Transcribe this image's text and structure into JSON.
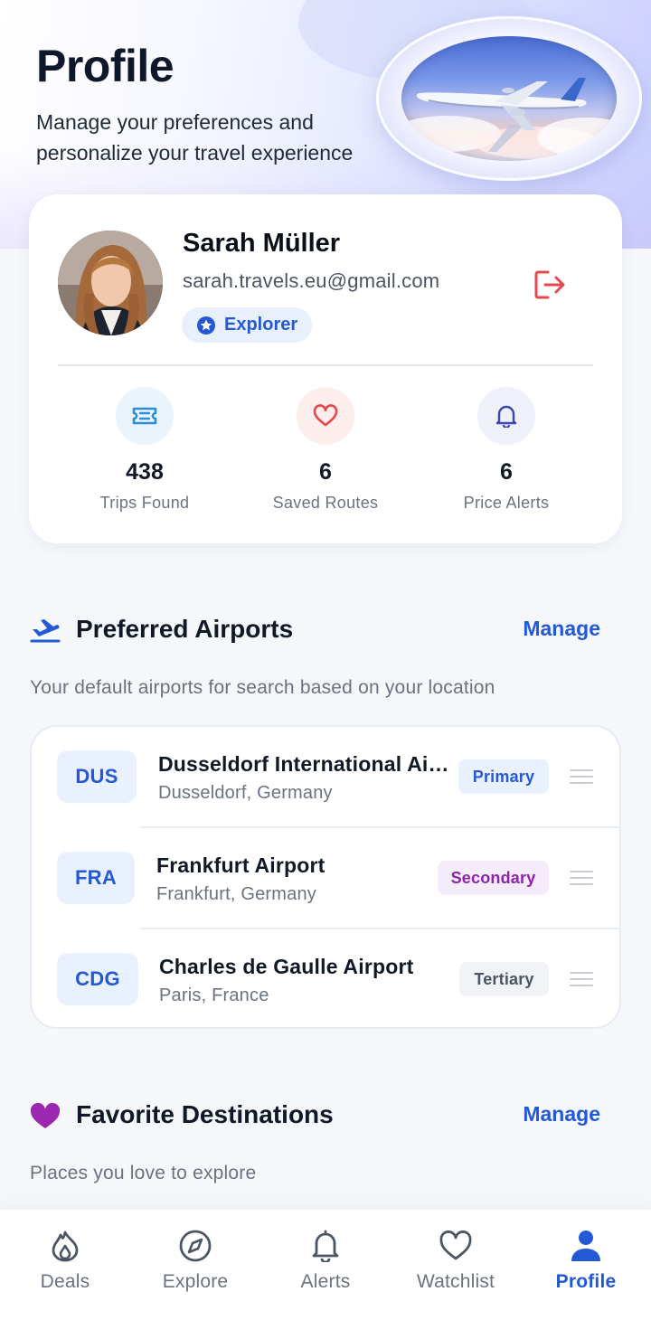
{
  "header": {
    "title": "Profile",
    "subtitle": "Manage your preferences and personalize your travel experience"
  },
  "user": {
    "name": "Sarah Müller",
    "email": "sarah.travels.eu@gmail.com",
    "tier": "Explorer"
  },
  "stats": [
    {
      "icon": "ticket-icon",
      "value": "438",
      "label": "Trips Found",
      "color": "#2b8fd6",
      "bg": "#eaf4fd"
    },
    {
      "icon": "heart-icon",
      "value": "6",
      "label": "Saved Routes",
      "color": "#e5484d",
      "bg": "#fdeeee"
    },
    {
      "icon": "bell-icon",
      "value": "6",
      "label": "Price Alerts",
      "color": "#3b47b8",
      "bg": "#eef0fa"
    }
  ],
  "preferred_airports": {
    "title": "Preferred Airports",
    "manage_label": "Manage",
    "description": "Your default airports for search based on your location",
    "items": [
      {
        "code": "DUS",
        "name": "Dusseldorf International Airport",
        "location": "Dusseldorf, Germany",
        "rank": "Primary",
        "rank_color": "#2459d6",
        "rank_bg": "#eaf1fe"
      },
      {
        "code": "FRA",
        "name": "Frankfurt Airport",
        "location": "Frankfurt, Germany",
        "rank": "Secondary",
        "rank_color": "#8e24aa",
        "rank_bg": "#f4ecfb"
      },
      {
        "code": "CDG",
        "name": "Charles de Gaulle Airport",
        "location": "Paris, France",
        "rank": "Tertiary",
        "rank_color": "#4b5563",
        "rank_bg": "#f1f3f6"
      }
    ]
  },
  "favorite_destinations": {
    "title": "Favorite Destinations",
    "manage_label": "Manage",
    "description": "Places you love to explore"
  },
  "nav": {
    "items": [
      {
        "icon": "flame-icon",
        "label": "Deals"
      },
      {
        "icon": "compass-icon",
        "label": "Explore"
      },
      {
        "icon": "bell-icon",
        "label": "Alerts"
      },
      {
        "icon": "heart-icon",
        "label": "Watchlist"
      },
      {
        "icon": "person-icon",
        "label": "Profile",
        "active": true
      }
    ]
  },
  "colors": {
    "accent": "#2459d6",
    "logout": "#e5484d",
    "favorite_heart": "#9c27b0"
  }
}
